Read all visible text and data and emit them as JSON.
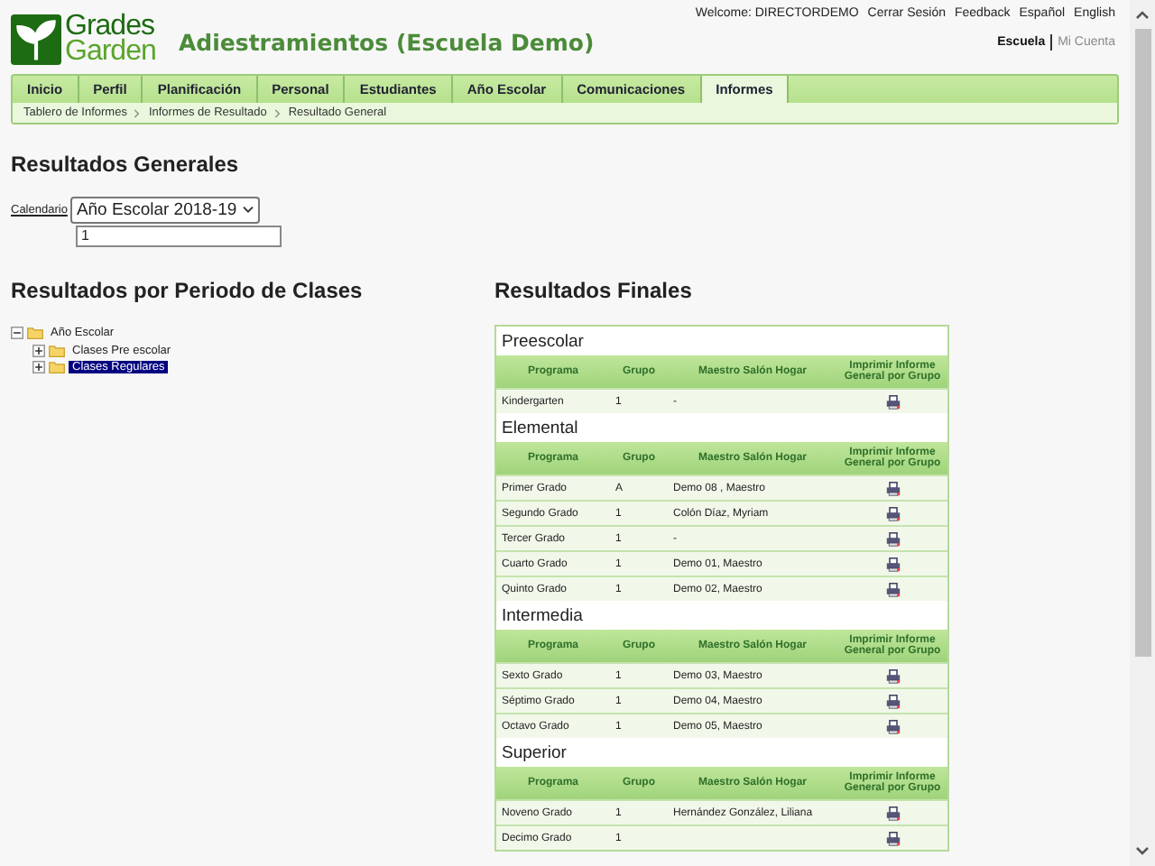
{
  "header": {
    "logo_lines": [
      "Grades",
      "Garden"
    ],
    "school_title": "Adiestramientos (Escuela Demo)",
    "user_links": [
      "Welcome: DIRECTORDEMO",
      "Cerrar Sesión",
      "Feedback",
      "Español",
      "English"
    ],
    "account_links": [
      {
        "label": "Escuela",
        "selected": true
      },
      {
        "label": "Mi Cuenta",
        "selected": false
      }
    ]
  },
  "tabs": [
    {
      "label": "Inicio",
      "selected": false
    },
    {
      "label": "Perfil",
      "selected": false
    },
    {
      "label": "Planificación",
      "selected": false
    },
    {
      "label": "Personal",
      "selected": false
    },
    {
      "label": "Estudiantes",
      "selected": false
    },
    {
      "label": "Año Escolar",
      "selected": false
    },
    {
      "label": "Comunicaciones",
      "selected": false
    },
    {
      "label": "Informes",
      "selected": true
    }
  ],
  "breadcrumbs": [
    "Tablero de Informes",
    "Informes de Resultado",
    "Resultado General"
  ],
  "general": {
    "title": "Resultados Generales",
    "calendar_label": "Calendario",
    "calendar_value": "Año Escolar 2018-19",
    "field_value": "1"
  },
  "periods": {
    "title": "Resultados por Periodo de Clases",
    "tree": {
      "label": "Año Escolar",
      "expanded": true,
      "selected": false,
      "children": [
        {
          "label": "Clases Pre escolar",
          "expanded": false,
          "selected": false
        },
        {
          "label": "Clases Regulares",
          "expanded": false,
          "selected": true
        }
      ]
    }
  },
  "results": {
    "title": "Resultados Finales",
    "sections": [
      {
        "title": "Preescolar",
        "columns": [
          "Programa",
          "Grupo",
          "Maestro Salón Hogar",
          "Imprimir Informe General por Grupo"
        ],
        "rows": [
          [
            "Kindergarten",
            "1",
            "-"
          ]
        ]
      },
      {
        "title": "Elemental",
        "columns": [
          "Programa",
          "Grupo",
          "Maestro Salón Hogar",
          "Imprimir Informe General por Grupo"
        ],
        "rows": [
          [
            "Primer Grado",
            "A",
            "Demo 08 , Maestro"
          ],
          [
            "Segundo Grado",
            "1",
            "Colón Díaz, Myriam"
          ],
          [
            "Tercer Grado",
            "1",
            "-"
          ],
          [
            "Cuarto Grado",
            "1",
            "Demo 01, Maestro"
          ],
          [
            "Quinto Grado",
            "1",
            "Demo 02, Maestro"
          ]
        ]
      },
      {
        "title": "Intermedia",
        "columns": [
          "Programa",
          "Grupo",
          "Maestro Salón Hogar",
          "Imprimir Informe General por Grupo"
        ],
        "rows": [
          [
            "Sexto Grado",
            "1",
            "Demo 03, Maestro"
          ],
          [
            "Séptimo Grado",
            "1",
            "Demo 04, Maestro"
          ],
          [
            "Octavo Grado",
            "1",
            "Demo 05, Maestro"
          ]
        ]
      },
      {
        "title": "Superior",
        "columns": [
          "Programa",
          "Grupo",
          "Maestro Salón Hogar",
          "Imprimir Informe General por Grupo"
        ],
        "rows": [
          [
            "Noveno Grado",
            "1",
            "Hernández González, Liliana"
          ],
          [
            "Decimo Grado",
            "1"
          ]
        ]
      }
    ]
  }
}
